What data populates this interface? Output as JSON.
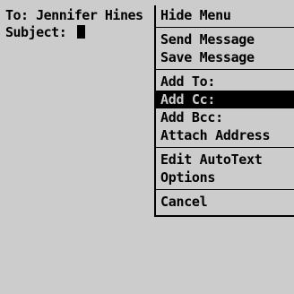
{
  "compose": {
    "to_label": "To:",
    "to_value": "Jennifer Hines",
    "subject_label": "Subject:"
  },
  "menu": {
    "groups": [
      [
        "Hide Menu"
      ],
      [
        "Send Message",
        "Save Message"
      ],
      [
        "Add To:",
        "Add Cc:",
        "Add Bcc:",
        "Attach Address"
      ],
      [
        "Edit AutoText",
        "Options"
      ],
      [
        "Cancel"
      ]
    ],
    "selected": "Add Cc:"
  }
}
